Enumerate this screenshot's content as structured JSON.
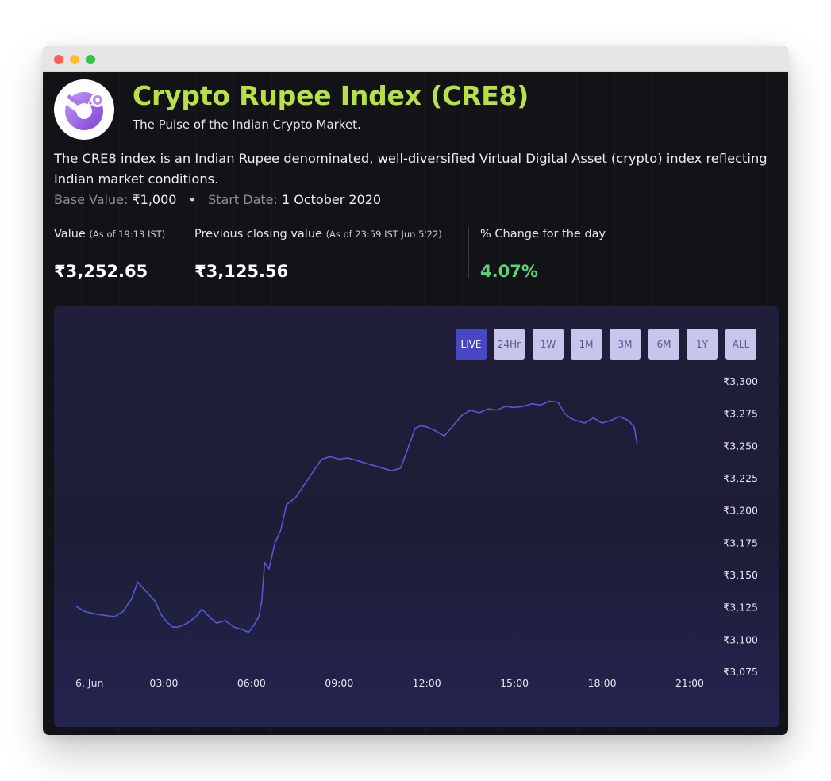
{
  "header": {
    "title": "Crypto Rupee Index (CRE8)",
    "tagline": "The Pulse of the Indian Crypto Market."
  },
  "description": "The CRE8 index is an Indian Rupee denominated, well-diversified Virtual Digital Asset (crypto) index reflecting Indian market conditions.",
  "meta": {
    "base_value_label": "Base Value:",
    "base_value": "₹1,000",
    "separator": "•",
    "start_date_label": "Start Date:",
    "start_date": "1 October 2020"
  },
  "stats": {
    "value": {
      "label": "Value",
      "note": "(As of 19:13 IST)",
      "amount": "₹3,252.65"
    },
    "previous": {
      "label": "Previous closing value",
      "note": "(As of 23:59 IST Jun 5'22)",
      "amount": "₹3,125.56"
    },
    "change": {
      "label": "% Change for the day",
      "amount": "4.07%"
    }
  },
  "range_buttons": [
    {
      "label": "LIVE",
      "active": true
    },
    {
      "label": "24Hr",
      "active": false
    },
    {
      "label": "1W",
      "active": false
    },
    {
      "label": "1M",
      "active": false
    },
    {
      "label": "3M",
      "active": false
    },
    {
      "label": "6M",
      "active": false
    },
    {
      "label": "1Y",
      "active": false
    },
    {
      "label": "ALL",
      "active": false
    }
  ],
  "colors": {
    "title": "#b8e04a",
    "positive": "#5ed27b",
    "line": "#5a57d4",
    "active_button": "#4848c6",
    "button": "#c7c5ec"
  },
  "icons": {
    "logo": "cre8-logo"
  },
  "chart_data": {
    "type": "line",
    "x_tick_labels": [
      "6. Jun",
      "03:00",
      "06:00",
      "09:00",
      "12:00",
      "15:00",
      "18:00",
      "21:00"
    ],
    "x_ticks_hours": [
      0,
      3,
      6,
      9,
      12,
      15,
      18,
      21
    ],
    "xlim_hours": [
      0,
      23.5
    ],
    "y_tick_labels": [
      "₹3,300",
      "₹3,275",
      "₹3,250",
      "₹3,225",
      "₹3,200",
      "₹3,175",
      "₹3,150",
      "₹3,125",
      "₹3,100",
      "₹3,075"
    ],
    "y_ticks": [
      3300,
      3275,
      3250,
      3225,
      3200,
      3175,
      3150,
      3125,
      3100,
      3075
    ],
    "ylim": [
      3075,
      3300
    ],
    "grid": false,
    "series": [
      {
        "x": [
          0,
          0.3,
          0.7,
          1.0,
          1.3,
          1.6,
          1.9,
          2.1,
          2.3,
          2.5,
          2.7,
          2.9,
          3.1,
          3.3,
          3.5,
          3.8,
          4.1,
          4.3,
          4.6,
          4.8,
          5.1,
          5.4,
          5.7,
          5.9,
          6.1,
          6.25,
          6.35,
          6.45,
          6.6,
          6.8,
          7.0,
          7.2,
          7.5,
          7.8,
          8.1,
          8.4,
          8.7,
          9.0,
          9.3,
          9.6,
          9.9,
          10.2,
          10.5,
          10.8,
          11.1,
          11.3,
          11.6,
          11.8,
          12.0,
          12.3,
          12.6,
          12.9,
          13.2,
          13.5,
          13.8,
          14.1,
          14.4,
          14.7,
          15.0,
          15.3,
          15.6,
          15.9,
          16.2,
          16.5,
          16.7,
          16.9,
          17.1,
          17.4,
          17.7,
          18.0,
          18.3,
          18.6,
          18.9,
          19.1,
          19.2
        ],
        "y": [
          3126,
          3122,
          3120,
          3119,
          3118,
          3122,
          3132,
          3145,
          3140,
          3135,
          3130,
          3120,
          3114,
          3110,
          3110,
          3113,
          3118,
          3124,
          3117,
          3113,
          3115,
          3110,
          3108,
          3106,
          3112,
          3118,
          3130,
          3160,
          3155,
          3175,
          3185,
          3205,
          3210,
          3220,
          3230,
          3240,
          3242,
          3240,
          3241,
          3239,
          3237,
          3235,
          3233,
          3231,
          3233,
          3245,
          3264,
          3266,
          3265,
          3262,
          3258,
          3266,
          3274,
          3278,
          3276,
          3279,
          3278,
          3281,
          3280,
          3281,
          3283,
          3282,
          3285,
          3284,
          3276,
          3272,
          3270,
          3268,
          3272,
          3268,
          3270,
          3273,
          3270,
          3265,
          3252
        ]
      }
    ]
  }
}
